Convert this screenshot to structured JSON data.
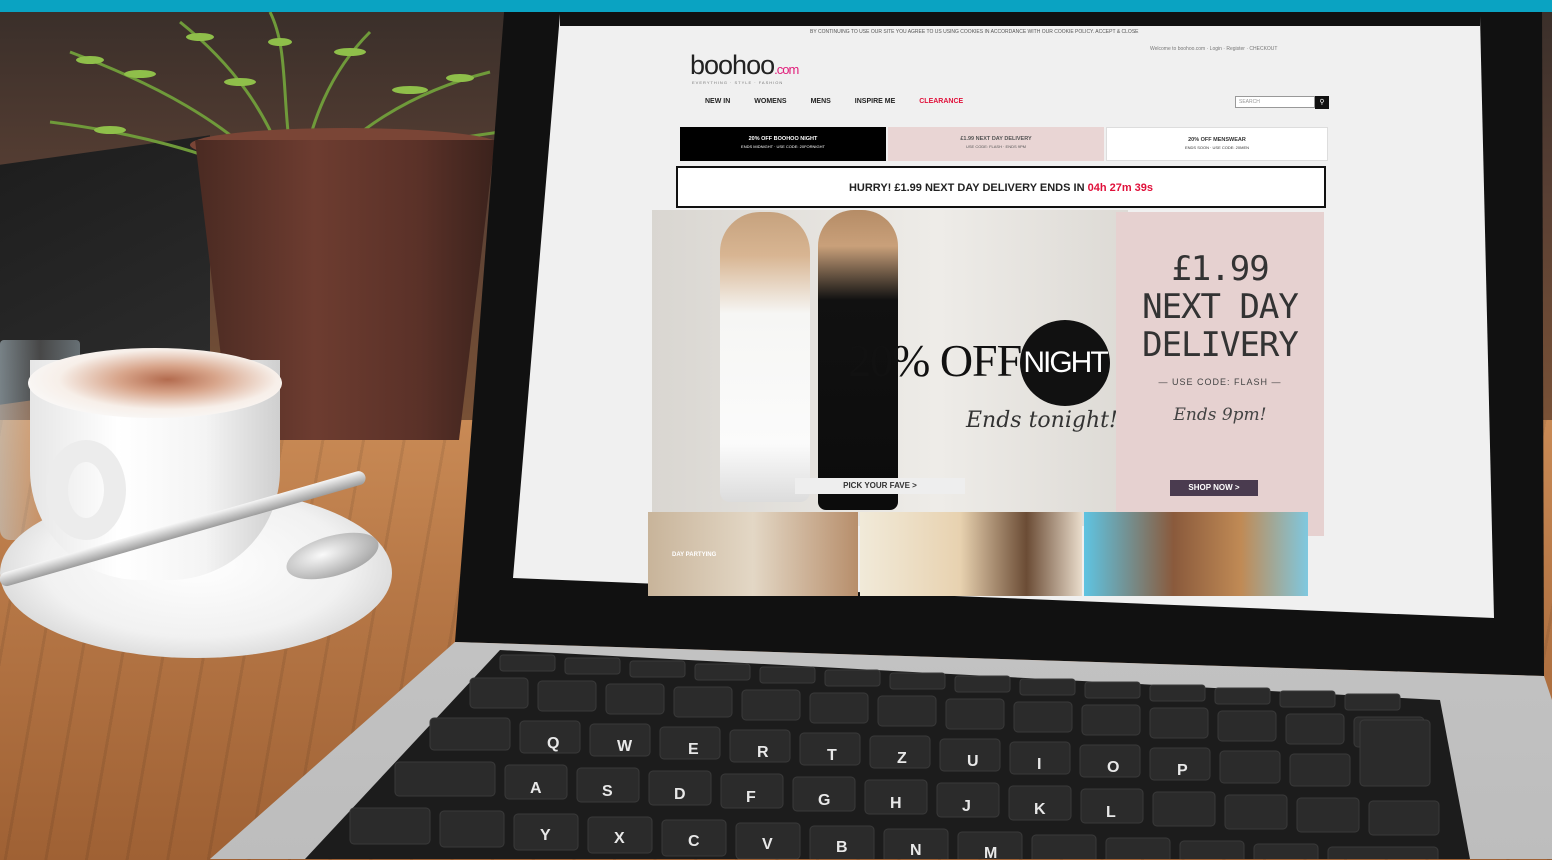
{
  "site": {
    "cookie_notice": "BY CONTINUING TO USE OUR SITE YOU AGREE TO US USING COOKIES IN ACCORDANCE WITH OUR COOKIE POLICY.   ACCEPT & CLOSE",
    "account_links": "Welcome to boohoo.com  ·  Login  ·  Register  ·  CHECKOUT",
    "logo_main": "boohoo",
    "logo_suffix": ".com",
    "tagline": "EVERYTHING · STYLE · FASHION",
    "nav": {
      "new_in": "NEW IN",
      "womens": "WOMENS",
      "mens": "MENS",
      "inspire_me": "INSPIRE ME",
      "clearance": "CLEARANCE"
    },
    "search_placeholder": "SEARCH",
    "promos": [
      {
        "title": "20% OFF BOOHOO NIGHT",
        "sub": "ENDS MIDNIGHT · USE CODE: 20FORNIGHT"
      },
      {
        "title": "£1.99 NEXT DAY DELIVERY",
        "sub": "USE CODE: FLASH · ENDS 9PM"
      },
      {
        "title": "20% OFF MENSWEAR",
        "sub": "ENDS SOON · USE CODE: 20MEN"
      }
    ],
    "hurry": {
      "text": "HURRY! £1.99 NEXT DAY DELIVERY ENDS IN ",
      "timer": "04h 27m 39s"
    },
    "hero": {
      "offer": "20% OFF",
      "badge": "NIGHT",
      "ends": "Ends tonight!",
      "cta": "PICK YOUR FAVE >"
    },
    "side": {
      "price": "£1.99",
      "line2": "NEXT DAY",
      "line3": "DELIVERY",
      "code": "— USE CODE: FLASH —",
      "ends": "Ends 9pm!",
      "cta": "SHOP NOW >"
    },
    "tile_label": "DAY PARTYING"
  },
  "colors": {
    "accent_band": "#0aa3c2",
    "brand_pink": "#e01d7a",
    "clearance_red": "#e0103a",
    "side_panel": "#e6d1d0"
  }
}
